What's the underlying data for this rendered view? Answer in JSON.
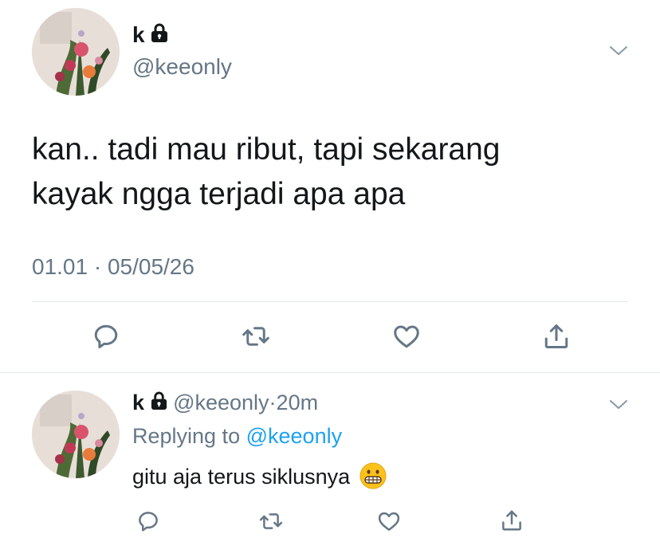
{
  "main_tweet": {
    "display_name": "k",
    "handle": "@keeonly",
    "text_line1": "kan.. tadi mau ribut, tapi sekarang",
    "text_line2": "kayak ngga terjadi apa apa",
    "timestamp": "01.01 · 05/05/26",
    "actions": [
      "reply-icon",
      "retweet-icon",
      "like-icon",
      "share-icon"
    ]
  },
  "reply": {
    "display_name": "k",
    "handle": "@keeonly",
    "separator": "·",
    "time": "20m",
    "replying_to_label": "Replying to",
    "replying_to_handle": "@keeonly",
    "text": "gitu aja terus siklusnya",
    "emoji": "😬",
    "actions": [
      "reply-icon",
      "retweet-icon",
      "like-icon",
      "share-icon"
    ]
  },
  "colors": {
    "text": "#14171a",
    "secondary": "#657786",
    "link": "#1da1f2",
    "divider": "#e1e8ed"
  }
}
